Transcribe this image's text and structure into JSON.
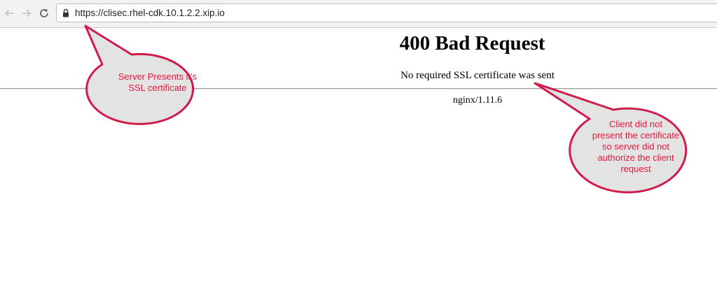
{
  "browser": {
    "url": "https://clisec.rhel-cdk.10.1.2.2.xip.io"
  },
  "page": {
    "title": "400 Bad Request",
    "message": "No required SSL certificate was sent",
    "server": "nginx/1.11.6"
  },
  "annotations": {
    "server_callout": [
      "Server Presents it's",
      "SSL certificate"
    ],
    "client_callout": [
      "Client did not",
      "present the certificate",
      "so server did not",
      "authorize the client",
      "request"
    ],
    "colors": {
      "stroke": "#d01c4b",
      "fill": "#e3e3e3",
      "text": "#e8163e"
    }
  }
}
